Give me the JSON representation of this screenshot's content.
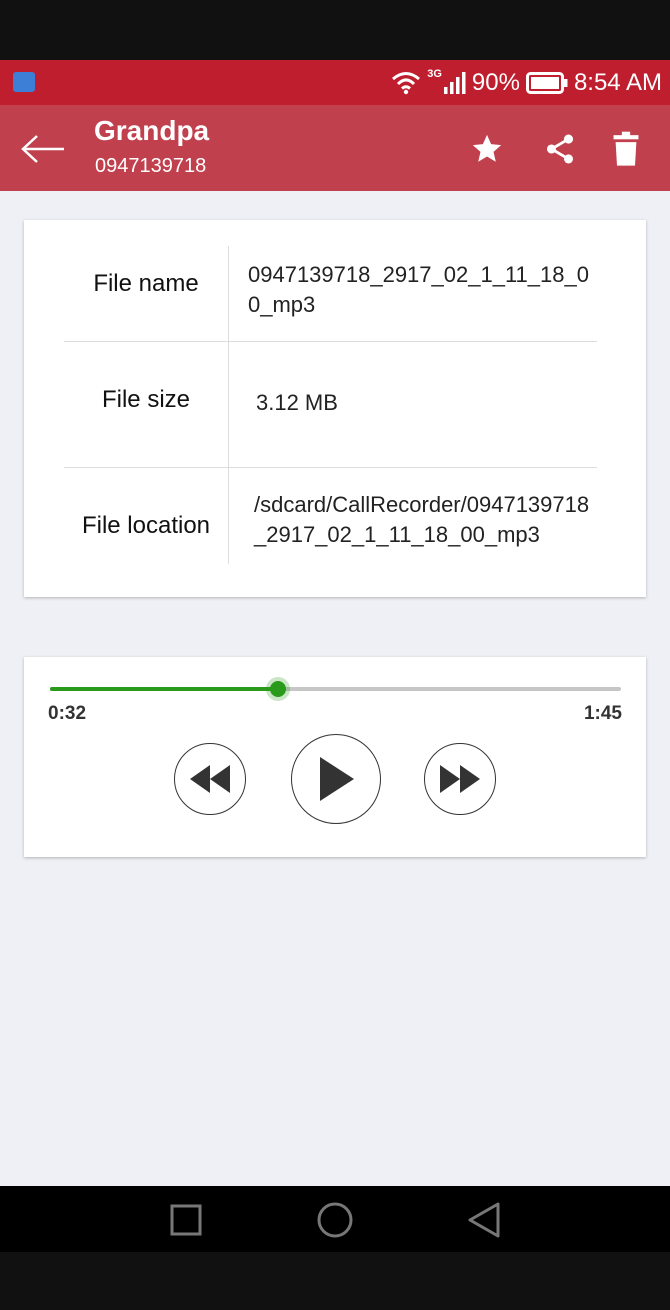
{
  "status_bar": {
    "network": "3G",
    "battery": "90%",
    "time": "8:54 AM"
  },
  "app_bar": {
    "contact_name": "Grandpa",
    "contact_number": "0947139718",
    "icons": [
      "back-arrow-icon",
      "star-icon",
      "share-icon",
      "delete-icon"
    ]
  },
  "file_info": {
    "rows": [
      {
        "label": "File name",
        "value": "0947139718_2917_02_1_11_18_00_mp3"
      },
      {
        "label": "File size",
        "value": "3.12 MB"
      },
      {
        "label": "File location",
        "value": "/sdcard/CallRecorder/0947139718_2917_02_1_11_18_00_mp3"
      }
    ]
  },
  "player": {
    "current_time": "0:32",
    "total_time": "1:45",
    "progress": 0.4,
    "accent_color": "#2a9a1a",
    "controls": [
      "rewind-icon",
      "play-icon",
      "fast-forward-icon"
    ]
  },
  "nav_bar": {
    "icons": [
      "recents-icon",
      "home-icon",
      "back-icon"
    ]
  },
  "colors": {
    "status_bar": "#bf1e2e",
    "app_bar": "#c0404d",
    "background": "#eff0f5"
  }
}
